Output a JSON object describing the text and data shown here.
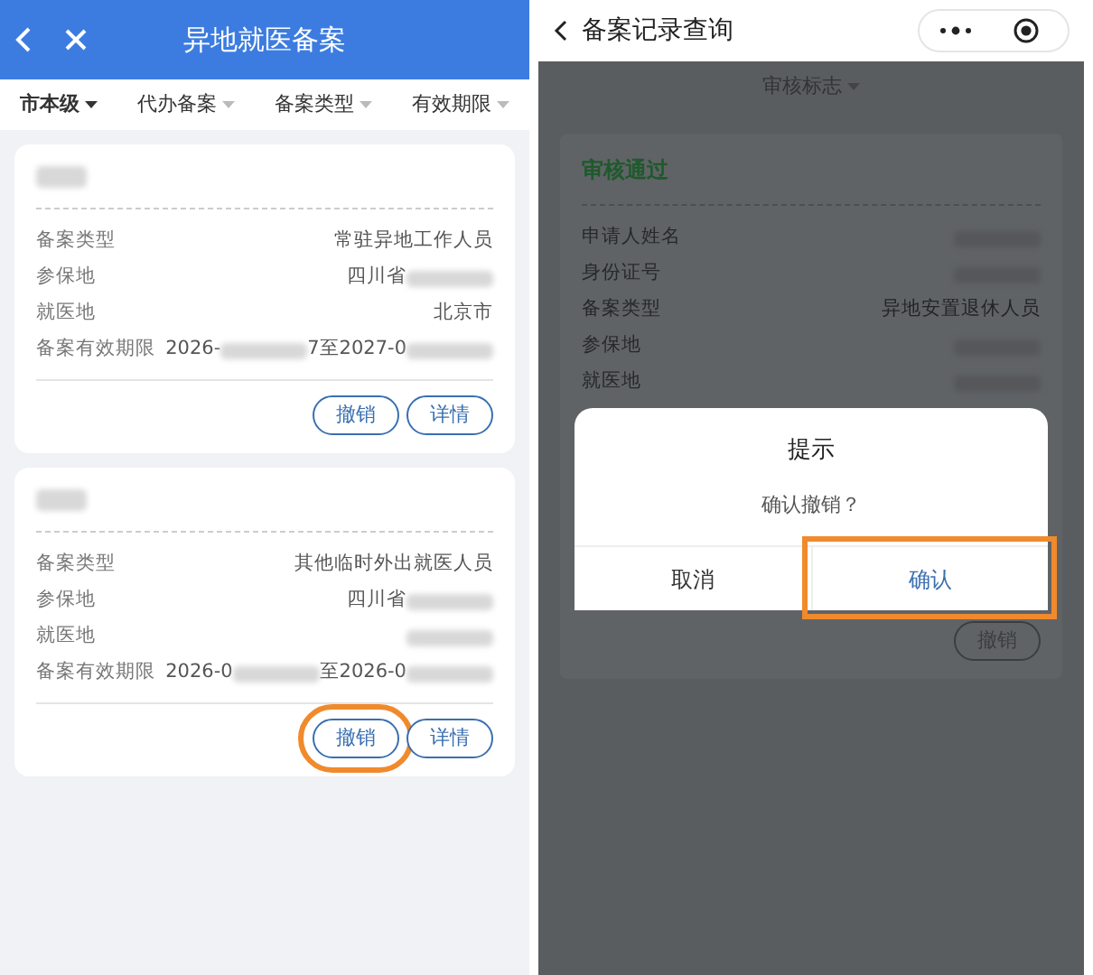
{
  "left_screen": {
    "title": "异地就医备案",
    "filters": [
      {
        "label": "市本级",
        "selected": true
      },
      {
        "label": "代办备案",
        "selected": false
      },
      {
        "label": "备案类型",
        "selected": false
      },
      {
        "label": "有效期限",
        "selected": false
      }
    ],
    "cards": [
      {
        "rows": [
          {
            "label": "备案类型",
            "value": [
              {
                "kind": "text",
                "text": "常驻异地工作人员"
              }
            ]
          },
          {
            "label": "参保地",
            "value": [
              {
                "kind": "text",
                "text": "四川省"
              },
              {
                "kind": "redacted"
              }
            ]
          },
          {
            "label": "就医地",
            "value": [
              {
                "kind": "text",
                "text": "北京市"
              }
            ]
          },
          {
            "label": "备案有效期限",
            "value": [
              {
                "kind": "text",
                "text": "2026-"
              },
              {
                "kind": "redacted"
              },
              {
                "kind": "text",
                "text": "7至2027-0"
              },
              {
                "kind": "redacted"
              }
            ]
          }
        ],
        "buttons": [
          {
            "label": "撤销",
            "highlighted": false
          },
          {
            "label": "详情",
            "highlighted": false
          }
        ]
      },
      {
        "rows": [
          {
            "label": "备案类型",
            "value": [
              {
                "kind": "text",
                "text": "其他临时外出就医人员"
              }
            ]
          },
          {
            "label": "参保地",
            "value": [
              {
                "kind": "text",
                "text": "四川省"
              },
              {
                "kind": "redacted"
              }
            ]
          },
          {
            "label": "就医地",
            "value": [
              {
                "kind": "redacted"
              }
            ]
          },
          {
            "label": "备案有效期限",
            "value": [
              {
                "kind": "text",
                "text": "2026-0"
              },
              {
                "kind": "redacted"
              },
              {
                "kind": "text",
                "text": "至2026-0"
              },
              {
                "kind": "redacted"
              }
            ]
          }
        ],
        "buttons": [
          {
            "label": "撤销",
            "highlighted": true
          },
          {
            "label": "详情",
            "highlighted": false
          }
        ]
      }
    ]
  },
  "right_screen": {
    "title": "备案记录查询",
    "filter": "审核标志",
    "status": "审核通过",
    "rows": [
      {
        "label": "申请人姓名",
        "value": [
          {
            "kind": "redacted"
          }
        ]
      },
      {
        "label": "身份证号",
        "value": [
          {
            "kind": "redacted"
          }
        ]
      },
      {
        "label": "备案类型",
        "value": [
          {
            "kind": "text",
            "text": "异地安置退休人员"
          }
        ]
      },
      {
        "label": "参保地",
        "value": [
          {
            "kind": "redacted"
          }
        ]
      },
      {
        "label": "就医地",
        "value": [
          {
            "kind": "redacted"
          }
        ]
      }
    ],
    "dialog": {
      "title": "提示",
      "message": "确认撤销？",
      "buttons": [
        {
          "label": "取消",
          "highlighted": false
        },
        {
          "label": "确认",
          "highlighted": true
        }
      ]
    },
    "button": "撤销"
  }
}
